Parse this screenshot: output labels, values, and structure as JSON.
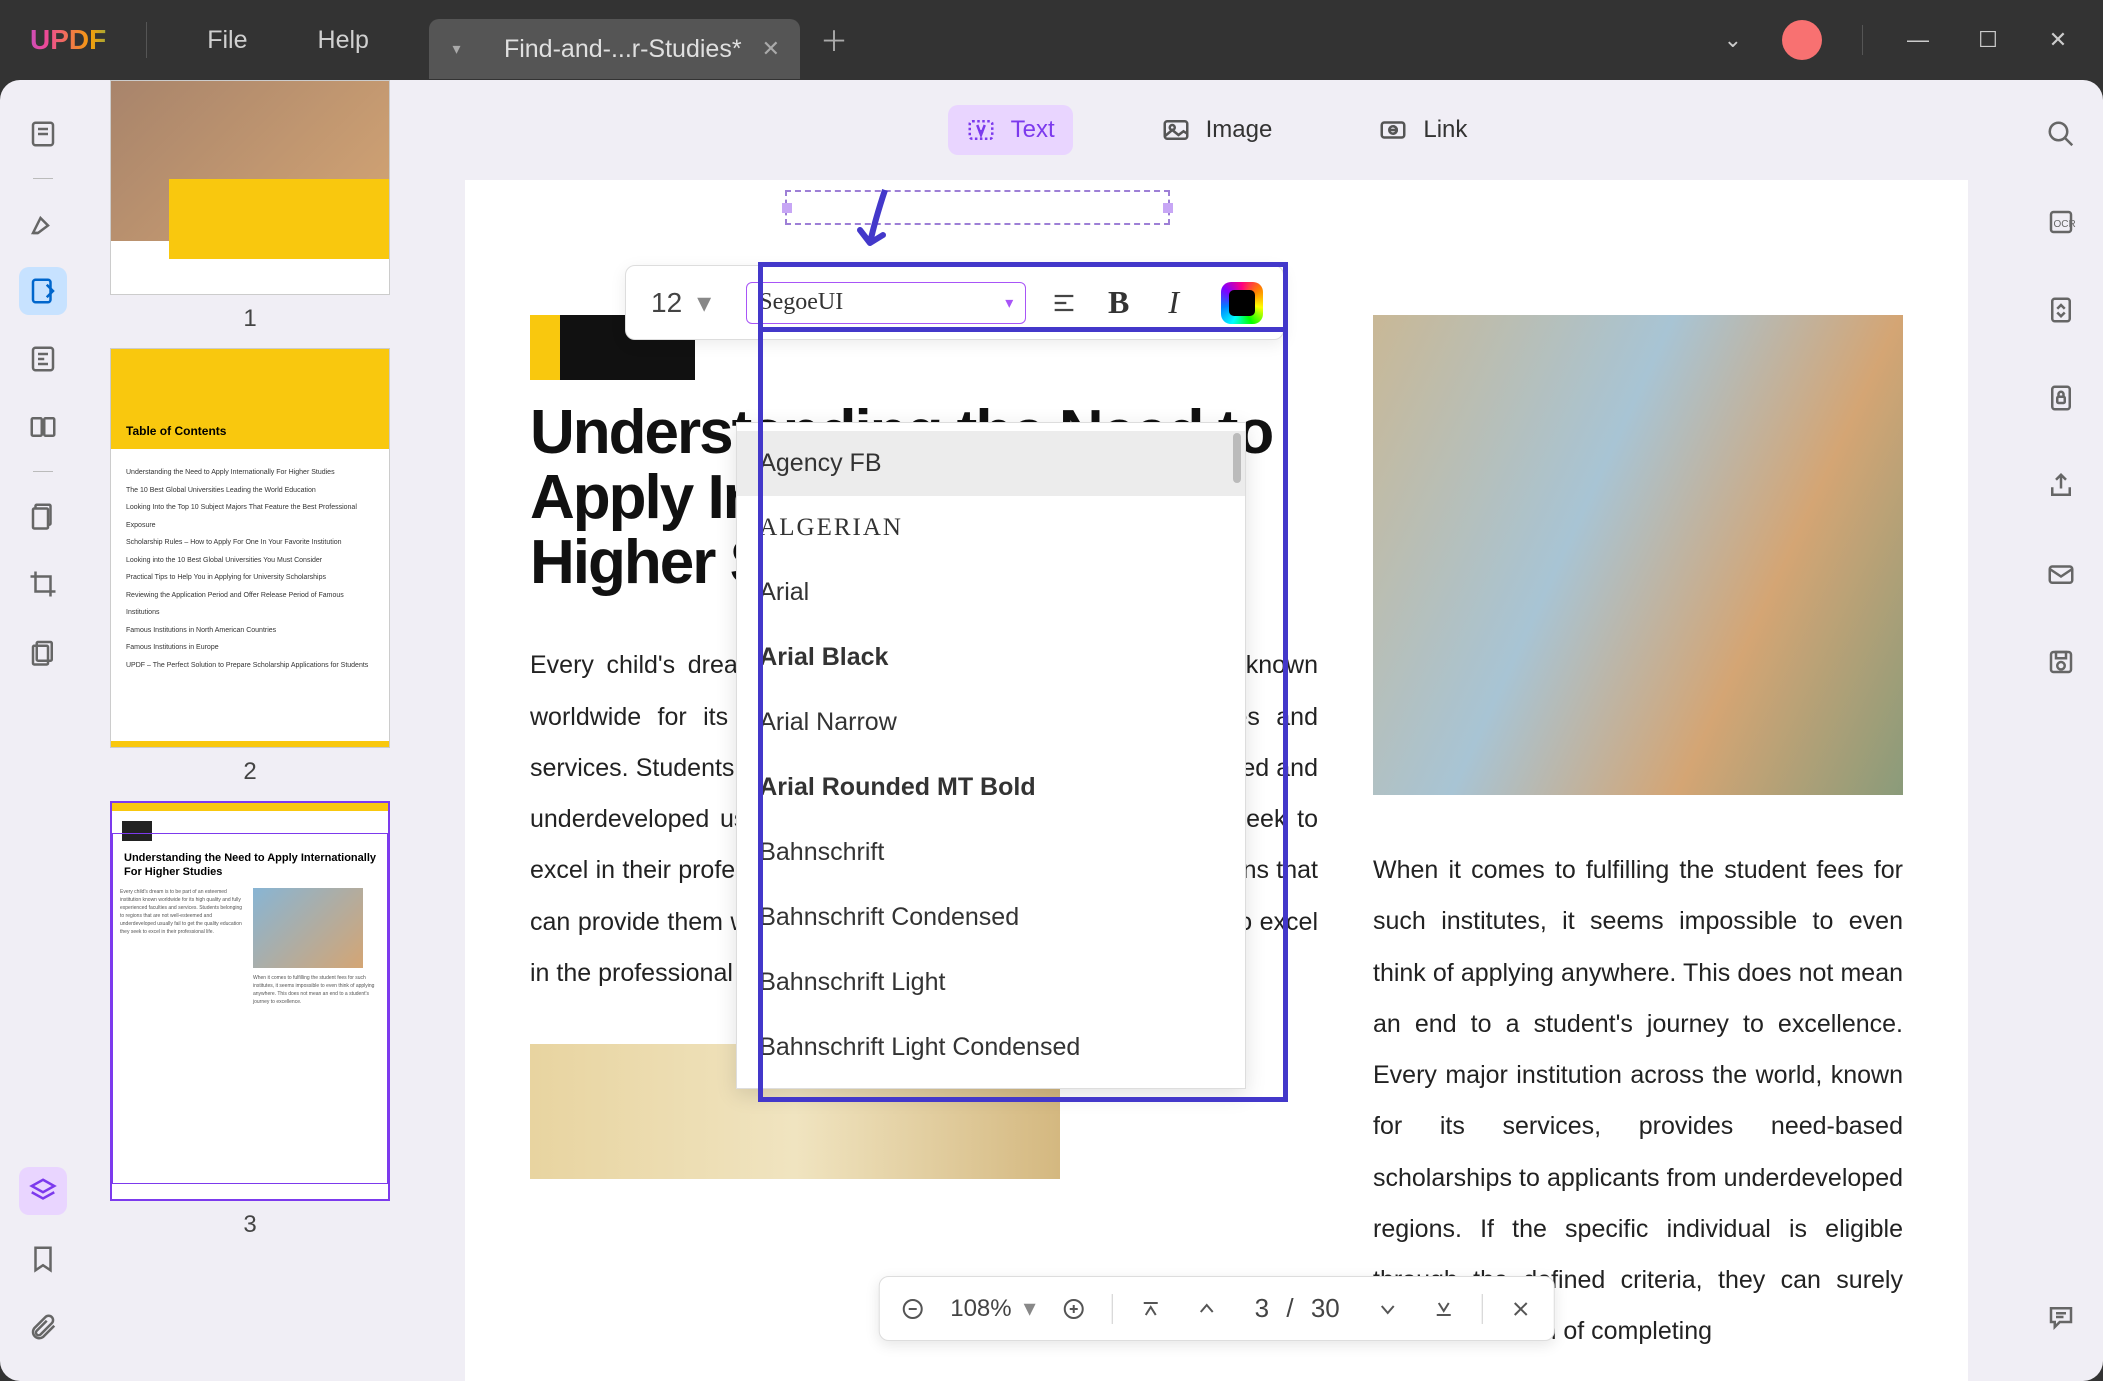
{
  "titlebar": {
    "logo": "UPDF",
    "menus": {
      "file": "File",
      "help": "Help"
    },
    "tab": {
      "title": "Find-and-...r-Studies*"
    },
    "window": {
      "min": "—",
      "max": "☐",
      "close": "✕"
    }
  },
  "left_rail": {
    "icons": [
      "reader",
      "highlight",
      "edit-text",
      "form",
      "sign",
      "tool-a",
      "crop",
      "pages"
    ],
    "bottom": [
      "layers",
      "bookmark",
      "attach"
    ]
  },
  "right_rail": {
    "icons": [
      "search",
      "ocr",
      "convert",
      "protect",
      "share",
      "mail",
      "save"
    ],
    "bottom": "comment"
  },
  "thumbs": {
    "p1": "1",
    "p2": "2",
    "p3": "3",
    "toc_title": "Table of Contents",
    "toc_lines": [
      "Understanding the Need to Apply Internationally For Higher Studies",
      "The 10 Best Global Universities Leading the World Education",
      "Looking Into the Top 10 Subject Majors That Feature the Best Professional Exposure",
      "Scholarship Rules – How to Apply For One In Your Favorite Institution",
      "Looking into the 10 Best Global Universities You Must Consider",
      "Practical Tips to Help You in Applying for University Scholarships",
      "Reviewing the Application Period and Offer Release Period of Famous Institutions",
      "Famous Institutions in North American Countries",
      "Famous Institutions in Europe",
      "UPDF – The Perfect Solution to Prepare Scholarship Applications for Students"
    ],
    "th3_title": "Understanding the Need to Apply Internationally For Higher Studies"
  },
  "edit_toolbar": {
    "text": "Text",
    "image": "Image",
    "link": "Link"
  },
  "format_bar": {
    "size": "12",
    "font": "SegoeUI",
    "fonts": [
      "Agency FB",
      "ALGERIAN",
      "Arial",
      "Arial Black",
      "Arial Narrow",
      "Arial Rounded MT Bold",
      "Bahnschrift",
      "Bahnschrift Condensed",
      "Bahnschrift Light",
      "Bahnschrift Light Condensed"
    ]
  },
  "document": {
    "title_lines": "Understanding the Need to Apply Internationally For Higher Studies",
    "para_left": "Every child's dream is to be part of an esteemed institution known worldwide for its high quality and fully experienced faculties and services. Students belonging to regions that are not well-esteemed and underdeveloped usually fail to get the quality education they seek to excel in their professional life. Thus, they look for better institutions that can provide them with the exposure that is necessary for them to excel in the professional field.",
    "para_right": "When it comes to fulfilling the student fees for such institutes, it seems impossible to even think of applying anywhere. This does not mean an end to a student's journey to excellence. Every major institution across the world, known for its services, provides need-based scholarships to applicants from underdeveloped regions. If the specific individual is eligible through the defined criteria, they can surely fulfill their dream of completing"
  },
  "zoom_bar": {
    "pct": "108%",
    "page": "3",
    "sep": "/",
    "total": "30"
  }
}
